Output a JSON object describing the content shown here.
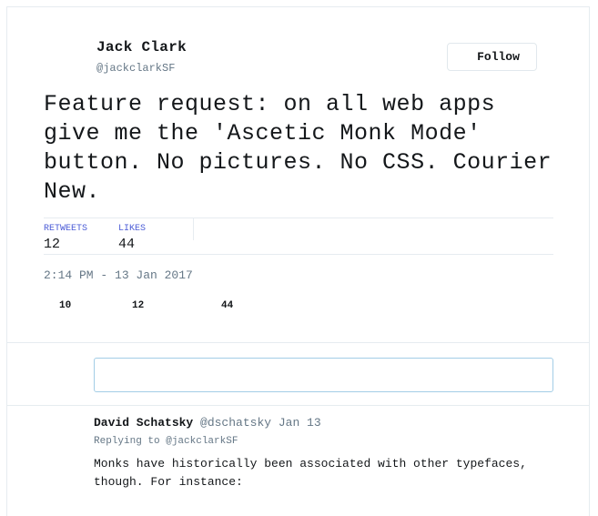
{
  "tweet": {
    "author_name": "Jack Clark",
    "author_handle": "@jackclarkSF",
    "follow_label": "Follow",
    "text": "Feature request: on all web apps give me the 'Ascetic Monk Mode' button. No pictures. No CSS. Courier New.",
    "retweets_label": "RETWEETS",
    "retweets_count": "12",
    "likes_label": "LIKES",
    "likes_count": "44",
    "timestamp": "2:14 PM - 13 Jan 2017"
  },
  "actions": {
    "replies_count": "10",
    "retweets_count": "12",
    "likes_count": "44"
  },
  "reply_box": {
    "value": ""
  },
  "reply": {
    "author_name": "David Schatsky",
    "author_handle_date": "@dschatsky Jan 13",
    "replying_to": "Replying to @jackclarkSF",
    "text": "Monks have historically been associated with other typefaces, though. For instance:"
  },
  "colors": {
    "stat_label": "#4a5bd6",
    "muted": "#657786",
    "border": "#e6ecf0",
    "input_border": "#a3cde6"
  }
}
